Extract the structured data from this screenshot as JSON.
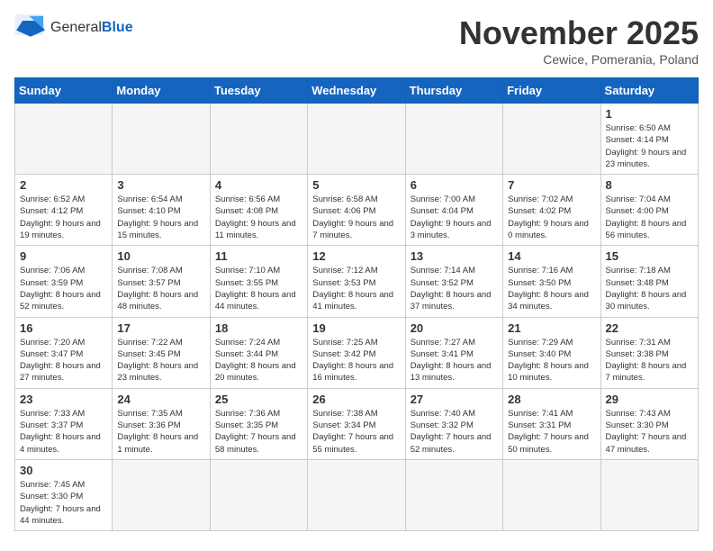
{
  "logo": {
    "text_general": "General",
    "text_blue": "Blue"
  },
  "title": "November 2025",
  "subtitle": "Cewice, Pomerania, Poland",
  "days_of_week": [
    "Sunday",
    "Monday",
    "Tuesday",
    "Wednesday",
    "Thursday",
    "Friday",
    "Saturday"
  ],
  "weeks": [
    [
      {
        "day": "",
        "info": ""
      },
      {
        "day": "",
        "info": ""
      },
      {
        "day": "",
        "info": ""
      },
      {
        "day": "",
        "info": ""
      },
      {
        "day": "",
        "info": ""
      },
      {
        "day": "",
        "info": ""
      },
      {
        "day": "1",
        "info": "Sunrise: 6:50 AM\nSunset: 4:14 PM\nDaylight: 9 hours and 23 minutes."
      }
    ],
    [
      {
        "day": "2",
        "info": "Sunrise: 6:52 AM\nSunset: 4:12 PM\nDaylight: 9 hours and 19 minutes."
      },
      {
        "day": "3",
        "info": "Sunrise: 6:54 AM\nSunset: 4:10 PM\nDaylight: 9 hours and 15 minutes."
      },
      {
        "day": "4",
        "info": "Sunrise: 6:56 AM\nSunset: 4:08 PM\nDaylight: 9 hours and 11 minutes."
      },
      {
        "day": "5",
        "info": "Sunrise: 6:58 AM\nSunset: 4:06 PM\nDaylight: 9 hours and 7 minutes."
      },
      {
        "day": "6",
        "info": "Sunrise: 7:00 AM\nSunset: 4:04 PM\nDaylight: 9 hours and 3 minutes."
      },
      {
        "day": "7",
        "info": "Sunrise: 7:02 AM\nSunset: 4:02 PM\nDaylight: 9 hours and 0 minutes."
      },
      {
        "day": "8",
        "info": "Sunrise: 7:04 AM\nSunset: 4:00 PM\nDaylight: 8 hours and 56 minutes."
      }
    ],
    [
      {
        "day": "9",
        "info": "Sunrise: 7:06 AM\nSunset: 3:59 PM\nDaylight: 8 hours and 52 minutes."
      },
      {
        "day": "10",
        "info": "Sunrise: 7:08 AM\nSunset: 3:57 PM\nDaylight: 8 hours and 48 minutes."
      },
      {
        "day": "11",
        "info": "Sunrise: 7:10 AM\nSunset: 3:55 PM\nDaylight: 8 hours and 44 minutes."
      },
      {
        "day": "12",
        "info": "Sunrise: 7:12 AM\nSunset: 3:53 PM\nDaylight: 8 hours and 41 minutes."
      },
      {
        "day": "13",
        "info": "Sunrise: 7:14 AM\nSunset: 3:52 PM\nDaylight: 8 hours and 37 minutes."
      },
      {
        "day": "14",
        "info": "Sunrise: 7:16 AM\nSunset: 3:50 PM\nDaylight: 8 hours and 34 minutes."
      },
      {
        "day": "15",
        "info": "Sunrise: 7:18 AM\nSunset: 3:48 PM\nDaylight: 8 hours and 30 minutes."
      }
    ],
    [
      {
        "day": "16",
        "info": "Sunrise: 7:20 AM\nSunset: 3:47 PM\nDaylight: 8 hours and 27 minutes."
      },
      {
        "day": "17",
        "info": "Sunrise: 7:22 AM\nSunset: 3:45 PM\nDaylight: 8 hours and 23 minutes."
      },
      {
        "day": "18",
        "info": "Sunrise: 7:24 AM\nSunset: 3:44 PM\nDaylight: 8 hours and 20 minutes."
      },
      {
        "day": "19",
        "info": "Sunrise: 7:25 AM\nSunset: 3:42 PM\nDaylight: 8 hours and 16 minutes."
      },
      {
        "day": "20",
        "info": "Sunrise: 7:27 AM\nSunset: 3:41 PM\nDaylight: 8 hours and 13 minutes."
      },
      {
        "day": "21",
        "info": "Sunrise: 7:29 AM\nSunset: 3:40 PM\nDaylight: 8 hours and 10 minutes."
      },
      {
        "day": "22",
        "info": "Sunrise: 7:31 AM\nSunset: 3:38 PM\nDaylight: 8 hours and 7 minutes."
      }
    ],
    [
      {
        "day": "23",
        "info": "Sunrise: 7:33 AM\nSunset: 3:37 PM\nDaylight: 8 hours and 4 minutes."
      },
      {
        "day": "24",
        "info": "Sunrise: 7:35 AM\nSunset: 3:36 PM\nDaylight: 8 hours and 1 minute."
      },
      {
        "day": "25",
        "info": "Sunrise: 7:36 AM\nSunset: 3:35 PM\nDaylight: 7 hours and 58 minutes."
      },
      {
        "day": "26",
        "info": "Sunrise: 7:38 AM\nSunset: 3:34 PM\nDaylight: 7 hours and 55 minutes."
      },
      {
        "day": "27",
        "info": "Sunrise: 7:40 AM\nSunset: 3:32 PM\nDaylight: 7 hours and 52 minutes."
      },
      {
        "day": "28",
        "info": "Sunrise: 7:41 AM\nSunset: 3:31 PM\nDaylight: 7 hours and 50 minutes."
      },
      {
        "day": "29",
        "info": "Sunrise: 7:43 AM\nSunset: 3:30 PM\nDaylight: 7 hours and 47 minutes."
      }
    ],
    [
      {
        "day": "30",
        "info": "Sunrise: 7:45 AM\nSunset: 3:30 PM\nDaylight: 7 hours and 44 minutes."
      },
      {
        "day": "",
        "info": ""
      },
      {
        "day": "",
        "info": ""
      },
      {
        "day": "",
        "info": ""
      },
      {
        "day": "",
        "info": ""
      },
      {
        "day": "",
        "info": ""
      },
      {
        "day": "",
        "info": ""
      }
    ]
  ]
}
